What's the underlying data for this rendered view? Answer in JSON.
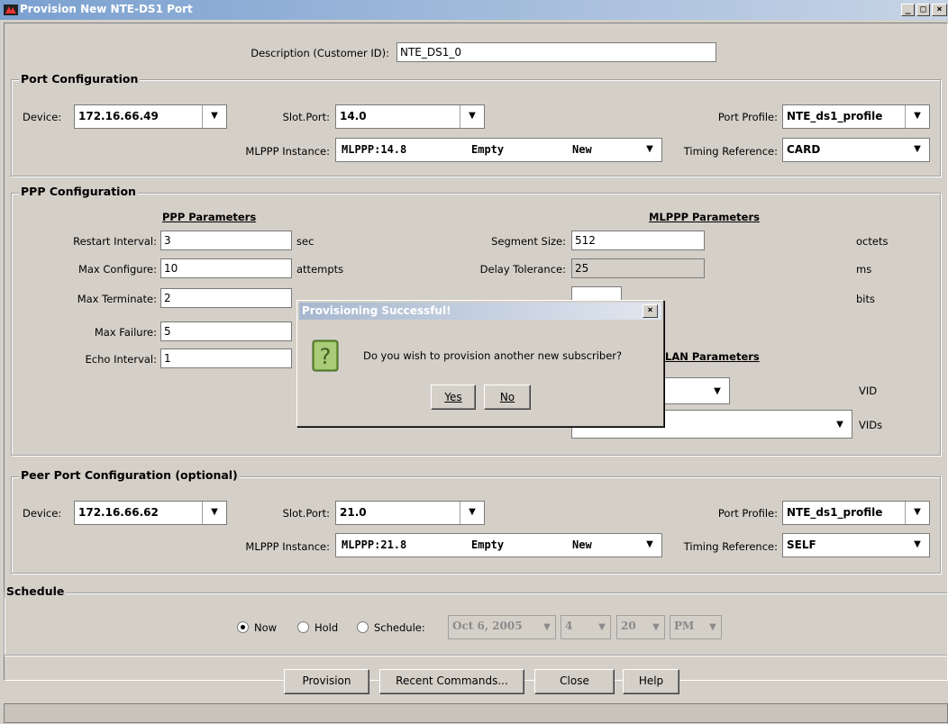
{
  "window": {
    "title": "Provision New NTE-DS1 Port",
    "controls": {
      "minimize": "_",
      "maximize": "□",
      "close": "×"
    }
  },
  "description": {
    "label": "Description (Customer ID):",
    "value": "NTE_DS1_0"
  },
  "port_config": {
    "title": "Port Configuration",
    "device_label": "Device:",
    "device_value": "172.16.66.49",
    "slot_label": "Slot.Port:",
    "slot_value": "14.0",
    "profile_label": "Port Profile:",
    "profile_value": "NTE_ds1_profile",
    "mlppp_label": "MLPPP Instance:",
    "mlppp_id": "MLPPP:14.8",
    "mlppp_state": "Empty",
    "mlppp_status": "New",
    "timing_label": "Timing Reference:",
    "timing_value": "CARD"
  },
  "ppp_config": {
    "title": "PPP Configuration",
    "ppp_header": "PPP Parameters",
    "mlppp_header": "MLPPP Parameters",
    "vlan_header": "LAN Parameters",
    "restart_label": "Restart Interval:",
    "restart_value": "3",
    "restart_unit": "sec",
    "maxconf_label": "Max Configure:",
    "maxconf_value": "10",
    "maxconf_unit": "attempts",
    "maxterm_label": "Max Terminate:",
    "maxterm_value": "2",
    "maxfail_label": "Max Failure:",
    "maxfail_value": "5",
    "echo_label": "Echo Interval:",
    "echo_value": "1",
    "segment_label": "Segment Size:",
    "segment_value": "512",
    "segment_unit": "octets",
    "delay_label": "Delay Tolerance:",
    "delay_value": "25",
    "delay_unit": "ms",
    "bits_unit": "bits",
    "vid_unit": "VID",
    "vids_unit": "VIDs"
  },
  "peer_config": {
    "title": "Peer Port Configuration (optional)",
    "device_label": "Device:",
    "device_value": "172.16.66.62",
    "slot_label": "Slot.Port:",
    "slot_value": "21.0",
    "profile_label": "Port Profile:",
    "profile_value": "NTE_ds1_profile",
    "mlppp_label": "MLPPP Instance:",
    "mlppp_id": "MLPPP:21.8",
    "mlppp_state": "Empty",
    "mlppp_status": "New",
    "timing_label": "Timing Reference:",
    "timing_value": "SELF"
  },
  "schedule": {
    "title": "Schedule",
    "now_label": "Now",
    "hold_label": "Hold",
    "schedule_label": "Schedule:",
    "selected": "Now",
    "date_value": "Oct 6, 2005",
    "hour_value": "4",
    "minute_value": "20",
    "ampm_value": "PM"
  },
  "buttons": {
    "provision": "Provision",
    "recent": "Recent Commands...",
    "close": "Close",
    "help": "Help"
  },
  "dialog": {
    "title": "Provisioning Successful!",
    "message": "Do you wish to provision another new subscriber?",
    "yes": "Yes",
    "no": "No",
    "close": "×"
  },
  "icons": {
    "app": "app-icon",
    "question": "question-icon",
    "dropdown": "dropdown-arrow-icon"
  },
  "colors": {
    "titlebar_start": "#7aa0d0",
    "titlebar_end": "#c7d4e6",
    "face": "#d4d0c8",
    "dialog_icon": "#6e9a3c"
  }
}
